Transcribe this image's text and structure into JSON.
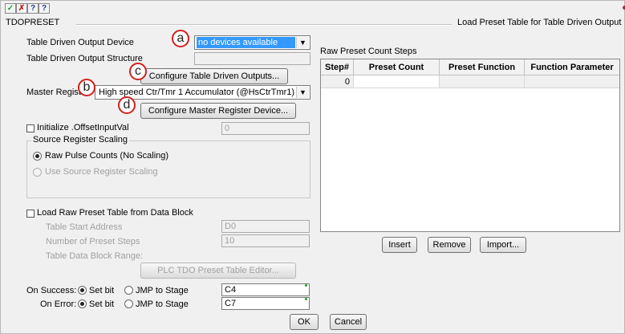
{
  "toolbar": {
    "ok_icon": "checkmark-icon",
    "cancel_icon": "x-icon",
    "third_label": "?",
    "help_label": "?"
  },
  "group": {
    "title": "TDOPRESET",
    "right_title": "Load Preset Table for Table Driven Output"
  },
  "annotations": [
    "a",
    "b",
    "c",
    "d"
  ],
  "left": {
    "tdo_device_label": "Table Driven Output Device",
    "tdo_device_value": "no devices available",
    "tdo_structure_label": "Table Driven Output Structure",
    "tdo_structure_value": "",
    "configure_tdo_button": "Configure Table Driven Outputs...",
    "master_register_label": "Master Register",
    "master_register_value": "High speed Ctr/Tmr 1 Accumulator (@HsCtrTmr1)",
    "configure_master_button": "Configure Master Register Device...",
    "init_offset_label": "Initialize .OffsetInputVal",
    "init_offset_value": "0",
    "source_scaling_title": "Source Register Scaling",
    "raw_pulse_label": "Raw Pulse Counts (No Scaling)",
    "use_source_label": "Use Source Register Scaling",
    "load_raw_label": "Load Raw Preset Table from Data Block",
    "table_start_label": "Table Start Address",
    "table_start_value": "D0",
    "num_steps_label": "Number of Preset Steps",
    "num_steps_value": "10",
    "data_block_range_label": "Table Data Block Range:",
    "plc_editor_button": "PLC TDO Preset Table Editor...",
    "on_success_label": "On Success:",
    "on_error_label": "On Error:",
    "set_bit_label": "Set bit",
    "jmp_label": "JMP to Stage",
    "success_value": "C4",
    "error_value": "C7"
  },
  "right": {
    "raw_steps_title": "Raw Preset Count Steps",
    "columns": [
      "Step#",
      "Preset Count",
      "Preset Function",
      "Function Parameter"
    ],
    "rows": [
      [
        "0",
        "",
        "",
        ""
      ]
    ],
    "insert_button": "Insert",
    "remove_button": "Remove",
    "import_button": "Import..."
  },
  "footer": {
    "ok_button": "OK",
    "cancel_button": "Cancel"
  },
  "colors": {
    "selection": "#3399ff",
    "annotation_circle": "#d22020"
  }
}
